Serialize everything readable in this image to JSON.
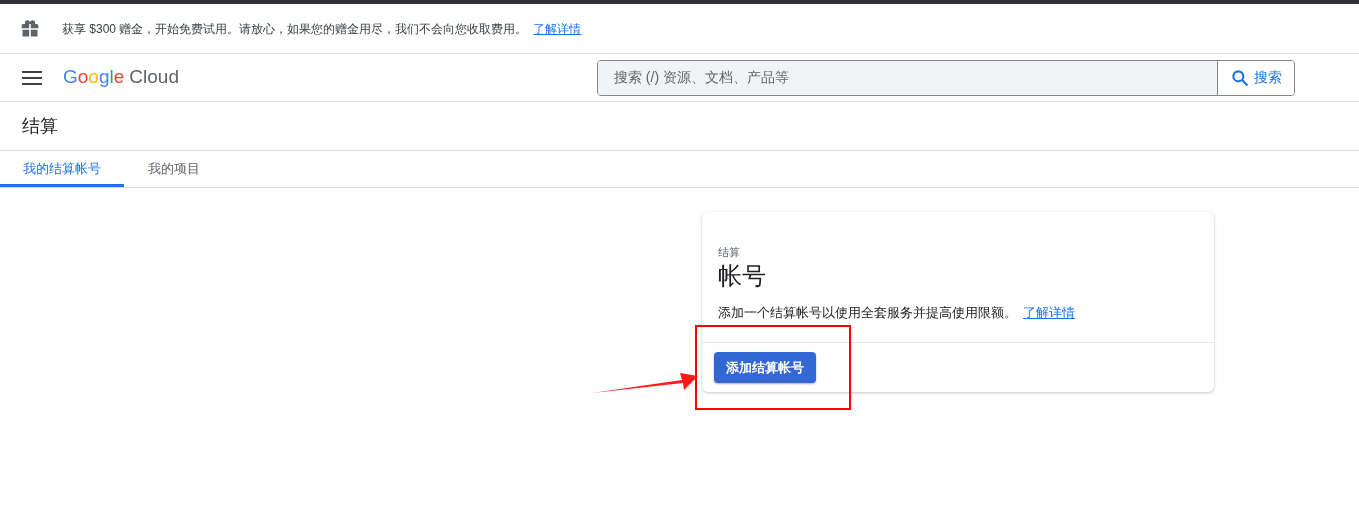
{
  "banner": {
    "text": "获享 $300 赠金，开始免费试用。请放心，如果您的赠金用尽，我们不会向您收取费用。",
    "link": "了解详情"
  },
  "header": {
    "logo_word": "Google",
    "logo_suffix": "Cloud",
    "search": {
      "placeholder": "搜索 (/) 资源、文档、产品等",
      "button": "搜索"
    }
  },
  "page_title": "结算",
  "tabs": [
    {
      "label": "我的结算帐号",
      "selected": true
    },
    {
      "label": "我的项目",
      "selected": false
    }
  ],
  "card": {
    "overline": "结算",
    "title": "帐号",
    "description": "添加一个结算帐号以使用全套服务并提高使用限额。",
    "link": "了解详情",
    "button": "添加结算帐号"
  }
}
